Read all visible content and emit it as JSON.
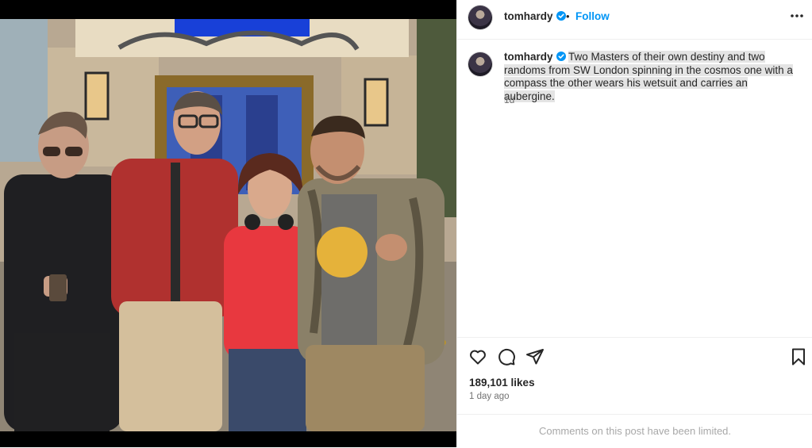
{
  "post": {
    "username": "tomhardy",
    "verified": true,
    "follow_label": "Follow",
    "separator": "•",
    "caption": "Two Masters of their own destiny and two randoms from SW London spinning in the cosmos one with a compass the other wears his wetsuit and carries an aubergine.",
    "caption_age": "1d",
    "likes": "189,101 likes",
    "posted": "1 day ago",
    "comments_notice": "Comments on this post have been limited."
  },
  "icons": {
    "like": "heart-icon",
    "comment": "comment-icon",
    "share": "send-icon",
    "save": "bookmark-icon",
    "more": "more-options-icon",
    "verified": "verified-badge-icon"
  },
  "colors": {
    "accent": "#0095f6",
    "verified": "#0095f6",
    "secondary_text": "#737373",
    "muted_text": "#a8a8a8"
  }
}
